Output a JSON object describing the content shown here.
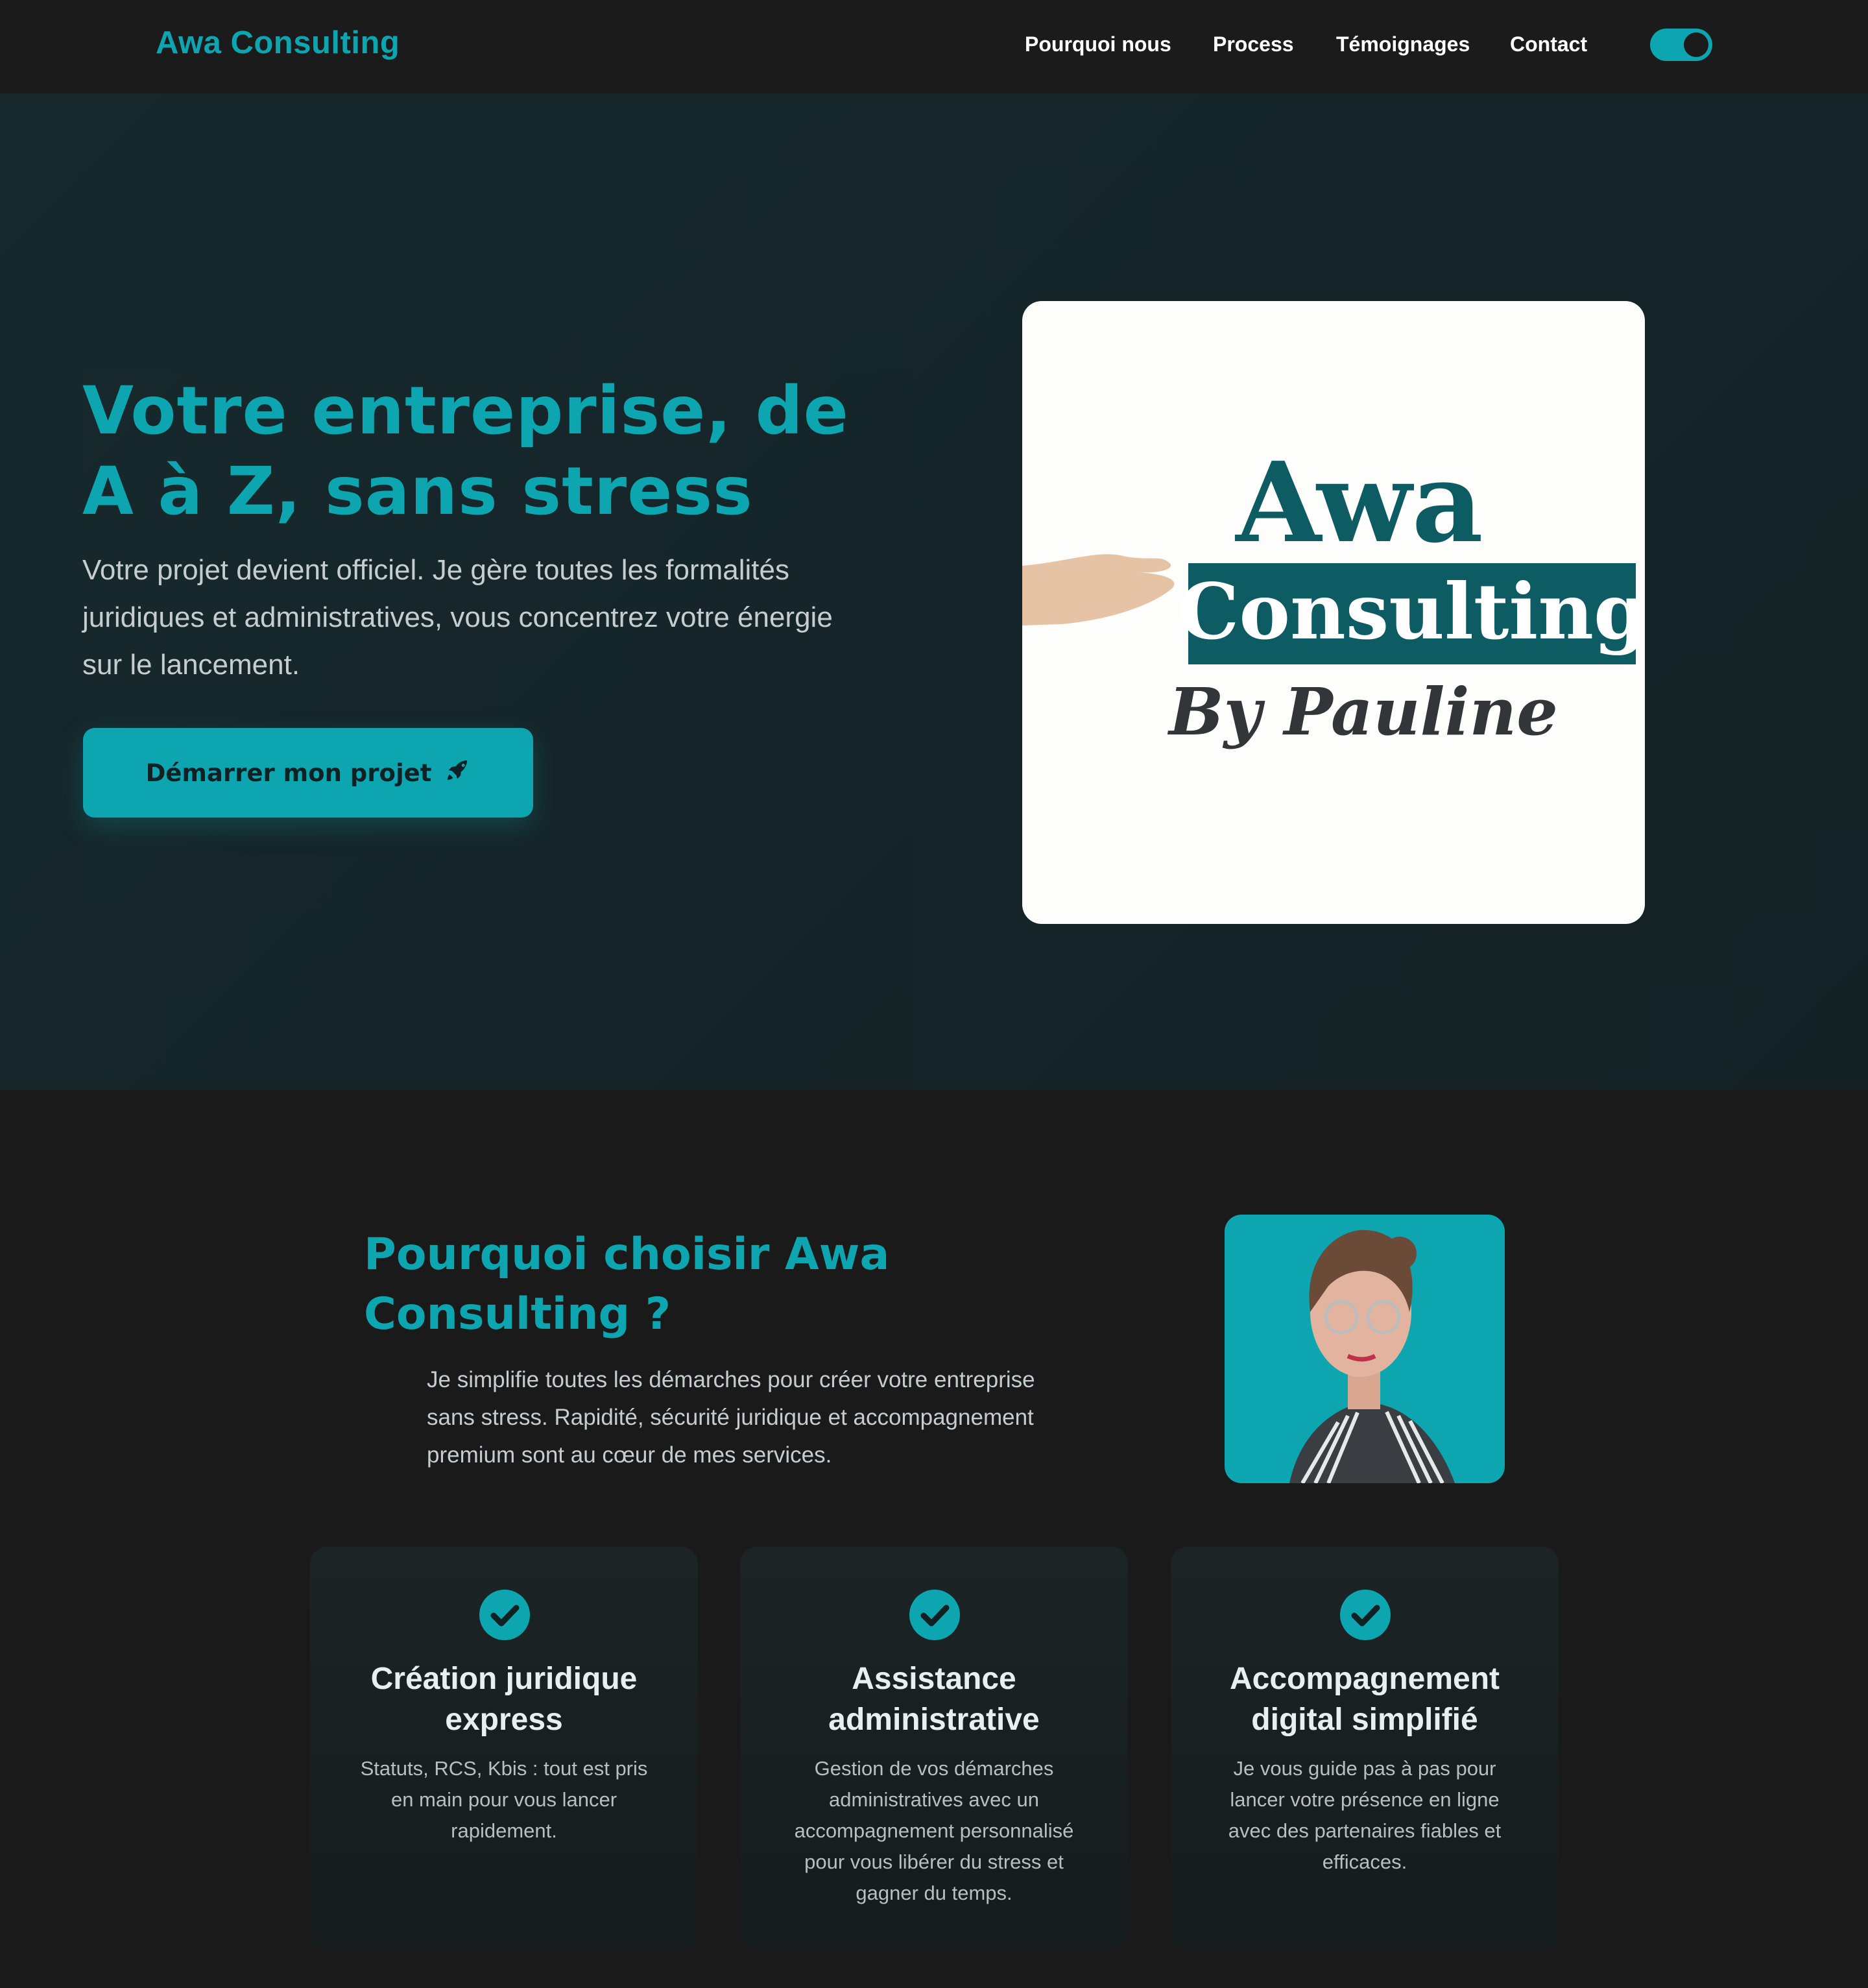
{
  "nav": {
    "brand": "Awa Consulting",
    "links": [
      "Pourquoi nous",
      "Process",
      "Témoignages",
      "Contact"
    ],
    "theme_toggle": "on"
  },
  "hero": {
    "title": "Votre entreprise, de A à Z, sans stress",
    "subtitle": "Votre projet devient officiel. Je gère toutes les formalités juridiques et administratives, vous concentrez votre énergie sur le lancement.",
    "cta_label": "Démarrer mon projet",
    "cta_icon": "rocket-icon",
    "logo_text": {
      "line1": "Awa",
      "line2": "Consulting",
      "line3": "By Pauline"
    }
  },
  "why": {
    "title": "Pourquoi choisir Awa Consulting ?",
    "lead": "Je simplifie toutes les démarches pour créer votre entreprise sans stress. Rapidité, sécurité juridique et accompagnement premium sont au cœur de mes services.",
    "cards": [
      {
        "title": "Création juridique express",
        "text": "Statuts, RCS, Kbis : tout est pris en main pour vous lancer rapidement.",
        "icon": "check-circle-icon"
      },
      {
        "title": "Assistance administrative",
        "text": "Gestion de vos démarches administratives avec un accompagnement personnalisé pour vous libérer du stress et gagner du temps.",
        "icon": "check-circle-icon"
      },
      {
        "title": "Accompagnement digital simplifié",
        "text": "Je vous guide pas à pas pour lancer votre présence en ligne avec des partenaires fiables et efficaces.",
        "icon": "check-circle-icon"
      }
    ]
  },
  "colors": {
    "accent": "#0ca5b0",
    "logo_teal": "#0d5c63",
    "nav_bg": "#1b1b1c",
    "hero_bg": "#17292d"
  }
}
